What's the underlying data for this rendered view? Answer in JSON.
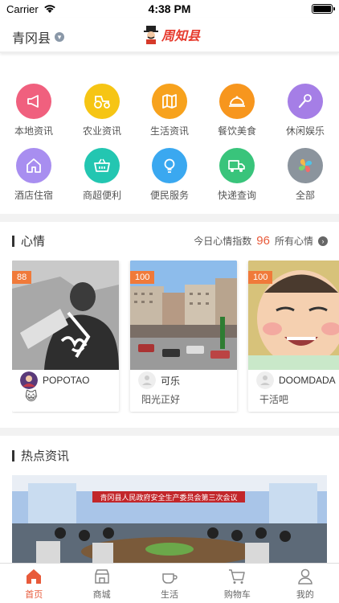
{
  "status_bar": {
    "carrier": "Carrier",
    "time": "4:38 PM"
  },
  "header": {
    "location": "青冈县",
    "logo_text": "周知县"
  },
  "grid": [
    {
      "label": "本地资讯",
      "icon": "megaphone-icon",
      "color": "#f0607e"
    },
    {
      "label": "农业资讯",
      "icon": "tractor-icon",
      "color": "#f6c514"
    },
    {
      "label": "生活资讯",
      "icon": "map-icon",
      "color": "#f7a21d"
    },
    {
      "label": "餐饮美食",
      "icon": "cloche-icon",
      "color": "#f7961e"
    },
    {
      "label": "休闲娱乐",
      "icon": "microphone-icon",
      "color": "#a57ee6"
    },
    {
      "label": "酒店住宿",
      "icon": "house-icon",
      "color": "#a88ef0"
    },
    {
      "label": "商超便利",
      "icon": "basket-icon",
      "color": "#23c6b1"
    },
    {
      "label": "便民服务",
      "icon": "lightbulb-icon",
      "color": "#3aa8f0"
    },
    {
      "label": "快递查询",
      "icon": "truck-icon",
      "color": "#39c47b"
    },
    {
      "label": "全部",
      "icon": "all-grid-icon",
      "color": "#8b949d"
    }
  ],
  "mood": {
    "title": "心情",
    "index_label": "今日心情指数",
    "index_value": "96",
    "all_label": "所有心情",
    "cards": [
      {
        "badge": "88",
        "user": "POPOTAO",
        "text": "😺"
      },
      {
        "badge": "100",
        "user": "可乐",
        "text": "阳光正好"
      },
      {
        "badge": "100",
        "user": "DOOMDADA",
        "text": "干活吧"
      }
    ]
  },
  "news": {
    "title": "热点资讯",
    "banner_text": "青冈县人民政府安全生产委员会第三次会议"
  },
  "tabs": [
    {
      "label": "首页",
      "icon": "home-icon",
      "active": true
    },
    {
      "label": "商城",
      "icon": "shop-icon",
      "active": false
    },
    {
      "label": "生活",
      "icon": "cup-icon",
      "active": false
    },
    {
      "label": "购物车",
      "icon": "cart-icon",
      "active": false
    },
    {
      "label": "我的",
      "icon": "user-icon",
      "active": false
    }
  ]
}
